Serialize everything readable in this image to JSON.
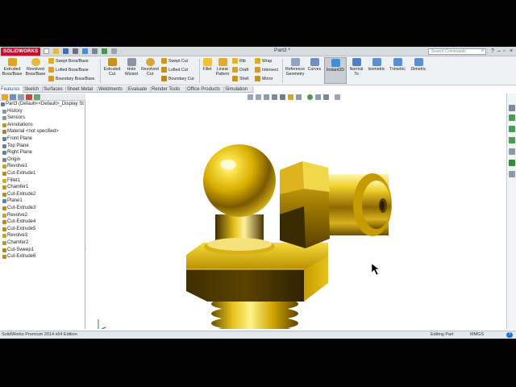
{
  "app": {
    "logo_text": "SOLIDWORKS",
    "title": "Part3 *"
  },
  "search": {
    "placeholder": "Search Commands"
  },
  "colors": {
    "accent": "#c8102e",
    "gold": "#d4a000",
    "ribbon_bg": "#eef1f4"
  },
  "ribbon": {
    "extruded_boss": "Extruded Boss/Base",
    "revolved_boss": "Revolved Boss/Base",
    "swept_boss": "Swept Boss/Base",
    "lofted_boss": "Lofted Boss/Base",
    "boundary_boss": "Boundary Boss/Base",
    "extruded_cut": "Extruded Cut",
    "hole_wizard": "Hole Wizard",
    "revolved_cut": "Revolved Cut",
    "swept_cut": "Swept Cut",
    "lofted_cut": "Lofted Cut",
    "boundary_cut": "Boundary Cut",
    "fillet": "Fillet",
    "linear_pattern": "Linear Pattern",
    "rib": "Rib",
    "draft": "Draft",
    "shell": "Shell",
    "wrap": "Wrap",
    "intersect": "Intersect",
    "mirror": "Mirror",
    "reference_geometry": "Reference Geometry",
    "curves": "Curves",
    "instant3d": "Instant3D",
    "normal_to": "Normal To",
    "isometric": "Isometric",
    "trimetric": "Trimetric",
    "dimetric": "Dimetric"
  },
  "tabs": [
    "Features",
    "Sketch",
    "Surfaces",
    "Sheet Metal",
    "Weldments",
    "Evaluate",
    "Render Tools",
    "Office Products",
    "Simulation"
  ],
  "tree": [
    "Part3  (Default<<Default>_Display St",
    "History",
    "Sensors",
    "Annotations",
    "Material <not specified>",
    "Front Plane",
    "Top Plane",
    "Right Plane",
    "Origin",
    "Revolve1",
    "Cut-Extrude1",
    "Fillet1",
    "Chamfer1",
    "Cut-Extrude2",
    "Plane1",
    "Cut-Extrude3",
    "Revolve2",
    "Cut-Extrude4",
    "Cut-Extrude5",
    "Revolve3",
    "Chamfer2",
    "Cut-Sweep1",
    "Cut-Extrude6"
  ],
  "status": {
    "product": "SolidWorks Premium 2014 x64 Edition",
    "mode": "Editing Part",
    "units": "MMGS"
  }
}
